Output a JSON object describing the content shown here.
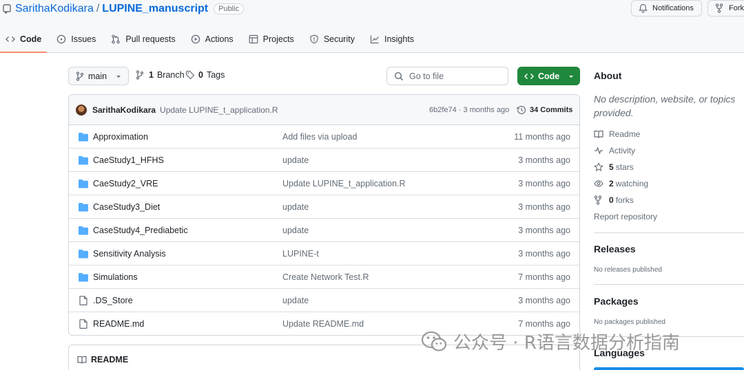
{
  "header": {
    "owner": "SarithaKodikara",
    "slash": "/",
    "repo": "LUPINE_manuscript",
    "visibility": "Public",
    "notifications_label": "Notifications",
    "fork_label": "Fork"
  },
  "tabs": [
    {
      "label": "Code",
      "icon": "code-icon",
      "active": true
    },
    {
      "label": "Issues",
      "icon": "issue-icon"
    },
    {
      "label": "Pull requests",
      "icon": "pull-request-icon"
    },
    {
      "label": "Actions",
      "icon": "play-icon"
    },
    {
      "label": "Projects",
      "icon": "table-icon"
    },
    {
      "label": "Security",
      "icon": "shield-icon"
    },
    {
      "label": "Insights",
      "icon": "graph-icon"
    }
  ],
  "toolbar": {
    "branch": "main",
    "branch_count": "1",
    "branch_label": "Branch",
    "tag_count": "0",
    "tag_label": "Tags",
    "goto_placeholder": "Go to file",
    "code_label": "Code"
  },
  "latest_commit": {
    "author": "SarithaKodikara",
    "message": "Update LUPINE_t_application.R",
    "hash_time": "6b2fe74 · 3 months ago",
    "count": "34 Commits"
  },
  "files": [
    {
      "name": "Approximation",
      "type": "folder",
      "message": "Add files via upload",
      "age": "11 months ago"
    },
    {
      "name": "CaeStudy1_HFHS",
      "type": "folder",
      "message": "update",
      "age": "3 months ago"
    },
    {
      "name": "CaeStudy2_VRE",
      "type": "folder",
      "message": "Update LUPINE_t_application.R",
      "age": "3 months ago"
    },
    {
      "name": "CaseStudy3_Diet",
      "type": "folder",
      "message": "update",
      "age": "3 months ago"
    },
    {
      "name": "CaseStudy4_Prediabetic",
      "type": "folder",
      "message": "update",
      "age": "3 months ago"
    },
    {
      "name": "Sensitivity Analysis",
      "type": "folder",
      "message": "LUPINE-t",
      "age": "3 months ago"
    },
    {
      "name": "Simulations",
      "type": "folder",
      "message": "Create Network Test.R",
      "age": "7 months ago"
    },
    {
      "name": ".DS_Store",
      "type": "file",
      "message": "update",
      "age": "3 months ago"
    },
    {
      "name": "README.md",
      "type": "file",
      "message": "Update README.md",
      "age": "7 months ago"
    }
  ],
  "readme_label": "README",
  "sidebar": {
    "about_title": "About",
    "about_desc": "No description, website, or topics provided.",
    "readme": "Readme",
    "activity": "Activity",
    "stars_count": "5",
    "stars_label": "stars",
    "watching_count": "2",
    "watching_label": "watching",
    "forks_count": "0",
    "forks_label": "forks",
    "report": "Report repository",
    "releases_title": "Releases",
    "releases_desc": "No releases published",
    "packages_title": "Packages",
    "packages_desc": "No packages published",
    "languages_title": "Languages"
  },
  "watermark": {
    "text": "公众号 · R语言数据分析指南"
  },
  "colors": {
    "link": "#0969da",
    "folder": "#54aeff",
    "primary_button": "#1f883d",
    "tab_underline": "#fd8c73",
    "language_bar": "#198ce7"
  }
}
